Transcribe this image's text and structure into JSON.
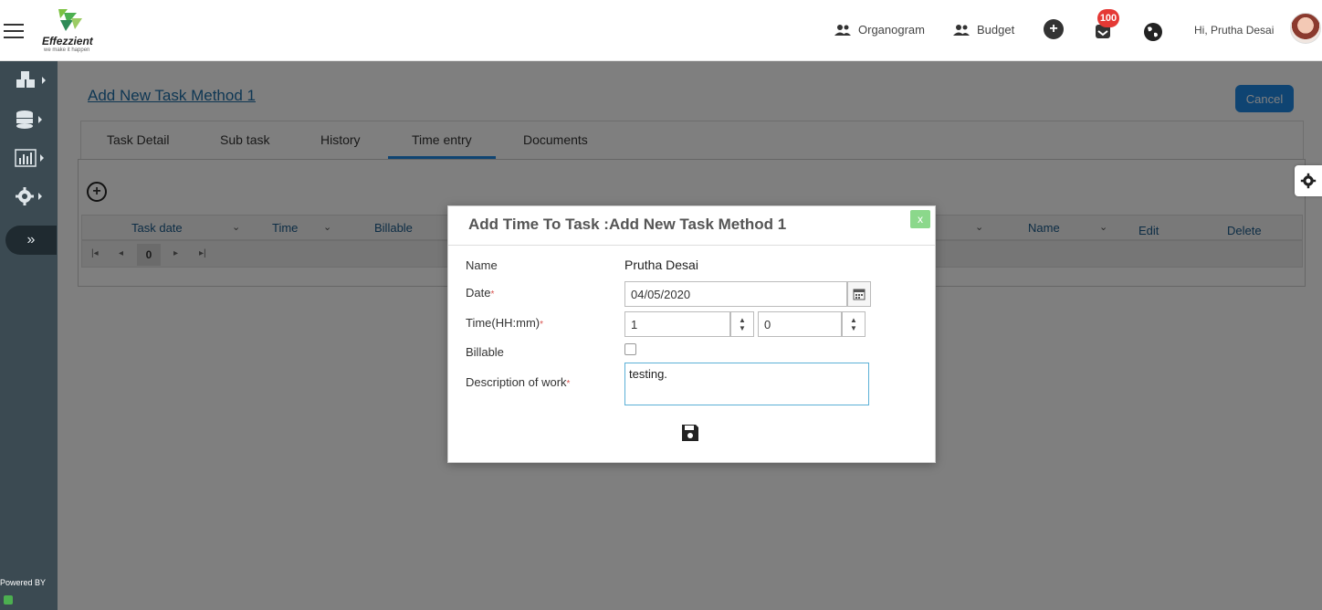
{
  "header": {
    "logo_text": "Effezzient",
    "logo_tagline": "we make it happen",
    "nav": [
      {
        "label": "Organogram",
        "icon": "people-icon"
      },
      {
        "label": "Budget",
        "icon": "people-icon"
      }
    ],
    "notification_count": "100",
    "greeting": "Hi, Prutha Desai"
  },
  "sidebar": {
    "icons": [
      "cubes-icon",
      "database-icon",
      "chart-icon",
      "gear-icon"
    ],
    "expand": "»",
    "powered_by": "Powered BY"
  },
  "page": {
    "title": "Add New Task Method 1",
    "cancel_label": "Cancel",
    "tabs": [
      "Task Detail",
      "Sub task",
      "History",
      "Time entry",
      "Documents"
    ],
    "active_tab": "Time entry"
  },
  "grid": {
    "columns_left": [
      "Task date",
      "Time",
      "Billable"
    ],
    "columns_right": [
      "Name",
      "Edit",
      "Delete"
    ],
    "page_number": "0"
  },
  "modal": {
    "title": "Add Time To Task :Add New Task Method 1",
    "close": "x",
    "labels": {
      "name": "Name",
      "date": "Date",
      "time": "Time(HH:mm)",
      "billable": "Billable",
      "description": "Description of work"
    },
    "required_mark": "*",
    "values": {
      "name": "Prutha Desai",
      "date": "04/05/2020",
      "hours": "1",
      "minutes": "0",
      "billable": false,
      "description": "testing."
    }
  },
  "colors": {
    "accent": "#1e88e5",
    "sidebar": "#3b4a52",
    "badge": "#e53935"
  }
}
